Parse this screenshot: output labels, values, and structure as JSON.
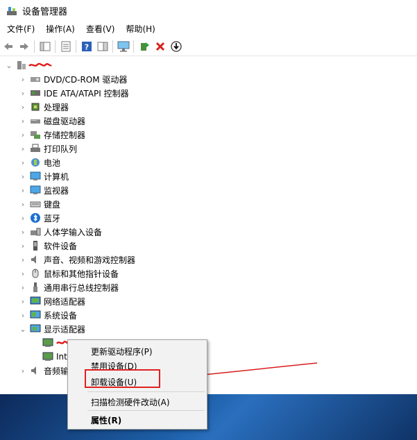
{
  "window": {
    "title": "设备管理器"
  },
  "menu": [
    "文件(F)",
    "操作(A)",
    "查看(V)",
    "帮助(H)"
  ],
  "tree": {
    "root": "",
    "categories": [
      {
        "label": "DVD/CD-ROM 驱动器",
        "icon": "dvd-drive-icon"
      },
      {
        "label": "IDE ATA/ATAPI 控制器",
        "icon": "ide-controller-icon"
      },
      {
        "label": "处理器",
        "icon": "processor-icon"
      },
      {
        "label": "磁盘驱动器",
        "icon": "disk-drive-icon"
      },
      {
        "label": "存储控制器",
        "icon": "storage-controller-icon"
      },
      {
        "label": "打印队列",
        "icon": "printer-icon"
      },
      {
        "label": "电池",
        "icon": "battery-icon"
      },
      {
        "label": "计算机",
        "icon": "computer-icon"
      },
      {
        "label": "监视器",
        "icon": "monitor-icon"
      },
      {
        "label": "键盘",
        "icon": "keyboard-icon"
      },
      {
        "label": "蓝牙",
        "icon": "bluetooth-icon"
      },
      {
        "label": "人体学输入设备",
        "icon": "hid-icon"
      },
      {
        "label": "软件设备",
        "icon": "software-device-icon"
      },
      {
        "label": "声音、视频和游戏控制器",
        "icon": "sound-icon"
      },
      {
        "label": "鼠标和其他指针设备",
        "icon": "mouse-icon"
      },
      {
        "label": "通用串行总线控制器",
        "icon": "usb-icon"
      },
      {
        "label": "网络适配器",
        "icon": "network-adapter-icon"
      },
      {
        "label": "系统设备",
        "icon": "system-device-icon"
      },
      {
        "label": "显示适配器",
        "icon": "display-adapter-icon"
      }
    ],
    "display_children": [
      "",
      "Int"
    ],
    "last_visible": "音频输"
  },
  "context_menu": {
    "update_driver": "更新驱动程序(P)",
    "disable_device": "禁用设备(D)",
    "uninstall_device": "卸载设备(U)",
    "scan_hardware": "扫描检测硬件改动(A)",
    "properties": "属性(R)"
  },
  "colors": {
    "highlight": "#e02020",
    "taskbar": "#1d5fa8"
  }
}
